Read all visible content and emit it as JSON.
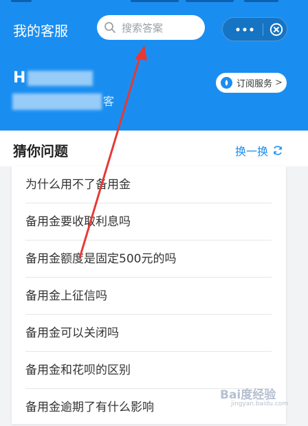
{
  "header": {
    "title": "我的客服",
    "search_placeholder": "搜索答案",
    "user_name": "H",
    "user_desc_tail": "客",
    "subscribe_label": "订阅服务",
    "subscribe_chevron": ">"
  },
  "section": {
    "title": "猜你问题",
    "refresh_label": "换一换"
  },
  "questions": [
    "为什么用不了备用金",
    "备用金要收取利息吗",
    "备用金额度是固定500元的吗",
    "备用金上征信吗",
    "备用金可以关闭吗",
    "备用金和花呗的区别",
    "备用金逾期了有什么影响"
  ],
  "watermark": {
    "brand": "Bai度经验",
    "url": "jingyan.baidu.com"
  },
  "colors": {
    "primary": "#1a8ef0",
    "annotation_arrow": "#e53935"
  }
}
